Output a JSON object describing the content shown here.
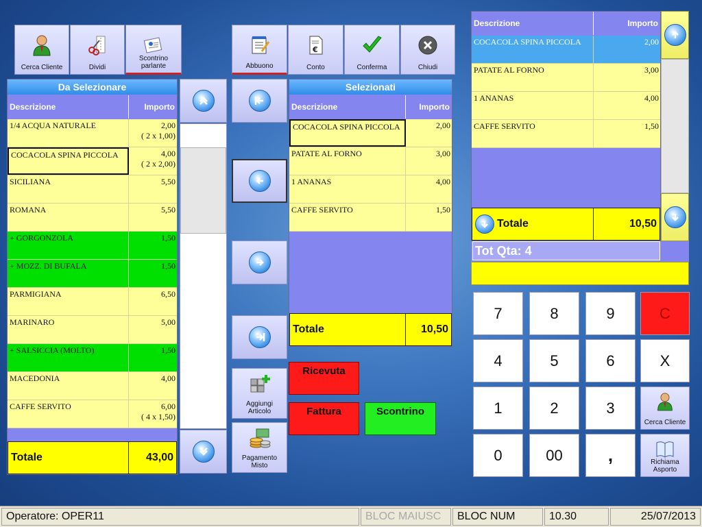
{
  "toolbar": {
    "cerca_cliente": "Cerca Cliente",
    "dividi": "Dividi",
    "scontrino_parlante": "Scontrino parlante",
    "abbuono": "Abbuono",
    "conto": "Conto",
    "conferma": "Conferma",
    "chiudi": "Chiudi"
  },
  "left_grid": {
    "title": "Da Selezionare",
    "col_desc": "Descrizione",
    "col_price": "Importo",
    "rows": [
      {
        "desc": "1/4 ACQUA NATURALE",
        "price": "2,00",
        "qty": "( 2 x 1,00)",
        "style": "yellow"
      },
      {
        "desc": "COCACOLA SPINA PICCOLA",
        "price": "4,00",
        "qty": "( 2 x 2,00)",
        "style": "yellow sel"
      },
      {
        "desc": "SICILIANA",
        "price": "5,50",
        "qty": "",
        "style": "yellow"
      },
      {
        "desc": "ROMANA",
        "price": "5,50",
        "qty": "",
        "style": "yellow"
      },
      {
        "desc": "+ GORGONZOLA",
        "price": "1,50",
        "qty": "",
        "style": "green"
      },
      {
        "desc": "+ MOZZ. DI BUFALA",
        "price": "1,50",
        "qty": "",
        "style": "green"
      },
      {
        "desc": "PARMIGIANA",
        "price": "6,50",
        "qty": "",
        "style": "yellow"
      },
      {
        "desc": "MARINARO",
        "price": "5,00",
        "qty": "",
        "style": "yellow"
      },
      {
        "desc": "+ SALSICCIA (MOLTO)",
        "price": "1,50",
        "qty": "",
        "style": "green"
      },
      {
        "desc": "MACEDONIA",
        "price": "4,00",
        "qty": "",
        "style": "yellow"
      },
      {
        "desc": "CAFFE SERVITO",
        "price": "6,00",
        "qty": "( 4 x 1,50)",
        "style": "yellow"
      }
    ],
    "total_label": "Totale",
    "total_value": "43,00"
  },
  "mid_grid": {
    "title": "Selezionati",
    "col_desc": "Descrizione",
    "col_price": "Importo",
    "rows": [
      {
        "desc": "COCACOLA SPINA PICCOLA",
        "price": "2,00",
        "style": "yellow sel"
      },
      {
        "desc": "PATATE AL FORNO",
        "price": "3,00",
        "style": "yellow"
      },
      {
        "desc": "1 ANANAS",
        "price": "4,00",
        "style": "yellow"
      },
      {
        "desc": "CAFFE SERVITO",
        "price": "1,50",
        "style": "yellow"
      }
    ],
    "total_label": "Totale",
    "total_value": "10,50"
  },
  "actions": {
    "aggiungi_articolo": "Aggiungi Articolo",
    "pagamento_misto": "Pagamento Misto",
    "ricevuta": "Ricevuta",
    "fattura": "Fattura",
    "scontrino": "Scontrino"
  },
  "right_grid": {
    "col_desc": "Descrizione",
    "col_price": "Importo",
    "rows": [
      {
        "desc": "COCACOLA SPINA PICCOLA",
        "price": "2,00",
        "style": "blue"
      },
      {
        "desc": "PATATE AL FORNO",
        "price": "3,00",
        "style": "yellow"
      },
      {
        "desc": "1 ANANAS",
        "price": "4,00",
        "style": "yellow"
      },
      {
        "desc": "CAFFE SERVITO",
        "price": "1,50",
        "style": "yellow"
      }
    ],
    "total_label": "Totale",
    "total_value": "10,50",
    "tot_qta": "Tot Qta: 4"
  },
  "keypad": {
    "k7": "7",
    "k8": "8",
    "k9": "9",
    "kc": "C",
    "k4": "4",
    "k5": "5",
    "k6": "6",
    "kx": "X",
    "k1": "1",
    "k2": "2",
    "k3": "3",
    "k0": "0",
    "k00": "00",
    "kcomma": ",",
    "cerca_cliente": "Cerca Cliente",
    "richiama_asporto": "Richiama Asporto"
  },
  "status": {
    "operatore": "Operatore: OPER11",
    "bloc_maiusc": "BLOC MAIUSC",
    "bloc_num": "BLOC NUM",
    "time": "10.30",
    "date": "25/07/2013"
  },
  "colors": {
    "yellow_row": "#ffff99",
    "green_row": "#00e000",
    "header_purple": "#8585f0",
    "total_yellow": "#ffff00",
    "red_button": "#ff1a1a",
    "green_button": "#22ee22"
  }
}
